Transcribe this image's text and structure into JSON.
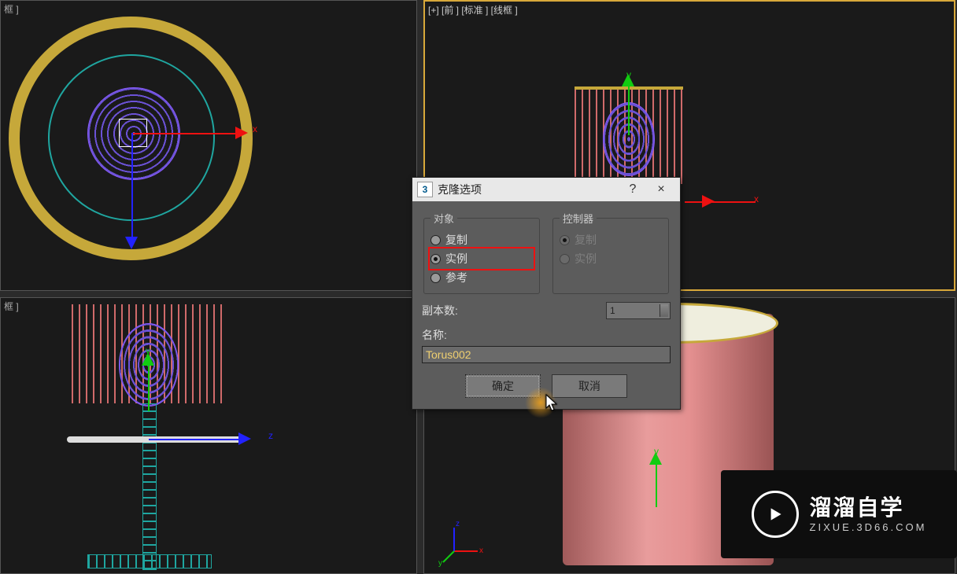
{
  "viewports": {
    "top_left_label": "框 ]",
    "top_right_label": "[+] [前 ] [标准 ] [线框 ]",
    "bottom_left_label": "框 ]",
    "bottom_right_label": ""
  },
  "dialog": {
    "title": "克隆选项",
    "icon_text": "3",
    "help_symbol": "?",
    "close_symbol": "×",
    "object_group": {
      "legend": "对象",
      "options": {
        "copy": "复制",
        "instance": "实例",
        "reference": "参考"
      },
      "selected": "instance"
    },
    "controller_group": {
      "legend": "控制器",
      "options": {
        "copy": "复制",
        "instance": "实例"
      },
      "selected": "copy",
      "disabled": true
    },
    "copies_label": "副本数:",
    "copies_value": "1",
    "name_label": "名称:",
    "name_value": "Torus002",
    "ok_label": "确定",
    "cancel_label": "取消"
  },
  "gizmo_labels": {
    "x": "x",
    "y": "y",
    "z": "z"
  },
  "watermark": {
    "title": "溜溜自学",
    "url": "ZIXUE.3D66.COM"
  }
}
